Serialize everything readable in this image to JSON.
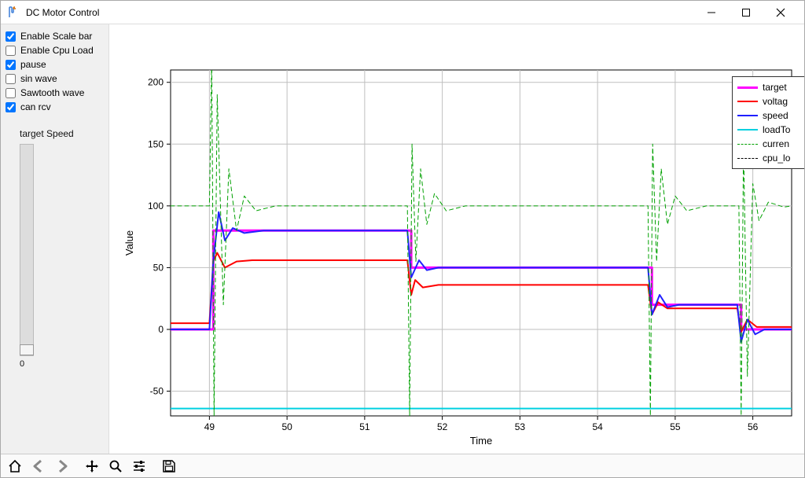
{
  "window": {
    "title": "DC Motor Control"
  },
  "sidebar": {
    "checks": [
      {
        "label": "Enable Scale bar",
        "checked": true
      },
      {
        "label": "Enable Cpu Load",
        "checked": false
      },
      {
        "label": "pause",
        "checked": true
      },
      {
        "label": "sin wave",
        "checked": false
      },
      {
        "label": "Sawtooth wave",
        "checked": false
      },
      {
        "label": "can rcv",
        "checked": true
      }
    ],
    "scale": {
      "label": "target Speed",
      "value": "0"
    }
  },
  "legend": {
    "items": [
      {
        "label": "target",
        "display": "target",
        "color": "#ff00ff",
        "style": "solid",
        "width": 3
      },
      {
        "label": "voltage",
        "display": "voltag",
        "color": "#ff0000",
        "style": "solid",
        "width": 2
      },
      {
        "label": "speed",
        "display": "speed",
        "color": "#2020ff",
        "style": "solid",
        "width": 2
      },
      {
        "label": "loadTorque",
        "display": "loadTo",
        "color": "#00d0e0",
        "style": "solid",
        "width": 2
      },
      {
        "label": "current",
        "display": "curren",
        "color": "#00a000",
        "style": "dashed",
        "width": 1
      },
      {
        "label": "cpu_load",
        "display": "cpu_lo",
        "color": "#000000",
        "style": "dashed",
        "width": 1
      }
    ]
  },
  "chart_data": {
    "type": "line",
    "xlabel": "Time",
    "ylabel": "Value",
    "xlim": [
      48.5,
      56.5
    ],
    "ylim": [
      -70,
      210
    ],
    "xticks": [
      49,
      50,
      51,
      52,
      53,
      54,
      55,
      56
    ],
    "yticks": [
      -50,
      0,
      50,
      100,
      150,
      200
    ],
    "grid": true,
    "series": [
      {
        "name": "target",
        "color": "#ff00ff",
        "style": "solid",
        "width": 3,
        "x": [
          48.5,
          49.05,
          49.05,
          51.6,
          51.6,
          54.7,
          54.7,
          55.85,
          55.85,
          56.5
        ],
        "y": [
          0,
          0,
          80,
          80,
          50,
          50,
          20,
          20,
          0,
          0
        ]
      },
      {
        "name": "voltage",
        "color": "#ff0000",
        "style": "solid",
        "width": 2,
        "x": [
          48.5,
          49.0,
          49.05,
          49.1,
          49.2,
          49.35,
          49.55,
          51.55,
          51.6,
          51.65,
          51.75,
          51.95,
          54.65,
          54.7,
          54.78,
          54.9,
          55.8,
          55.85,
          55.93,
          56.05,
          56.5
        ],
        "y": [
          5,
          5,
          55,
          62,
          50,
          55,
          56,
          56,
          28,
          40,
          34,
          36,
          36,
          12,
          22,
          17,
          17,
          -2,
          8,
          2,
          2
        ]
      },
      {
        "name": "speed",
        "color": "#2020ff",
        "style": "solid",
        "width": 2,
        "x": [
          48.5,
          49.0,
          49.05,
          49.12,
          49.2,
          49.3,
          49.45,
          49.7,
          51.55,
          51.6,
          51.7,
          51.8,
          51.95,
          54.65,
          54.7,
          54.8,
          54.9,
          55.05,
          55.8,
          55.85,
          55.93,
          56.03,
          56.15,
          56.5
        ],
        "y": [
          0,
          0,
          55,
          95,
          72,
          82,
          78,
          80,
          80,
          42,
          56,
          48,
          50,
          50,
          12,
          28,
          18,
          20,
          20,
          -10,
          8,
          -4,
          0,
          0
        ]
      },
      {
        "name": "loadTorque",
        "color": "#00d0e0",
        "style": "solid",
        "width": 2,
        "x": [
          48.5,
          56.5
        ],
        "y": [
          -64,
          -64
        ]
      },
      {
        "name": "current",
        "color": "#00a000",
        "style": "dashed",
        "width": 1,
        "x": [
          48.5,
          49.0,
          49.03,
          49.06,
          49.1,
          49.18,
          49.25,
          49.35,
          49.45,
          49.6,
          49.85,
          51.55,
          51.58,
          51.61,
          51.66,
          51.72,
          51.8,
          51.9,
          52.05,
          52.3,
          54.65,
          54.68,
          54.71,
          54.76,
          54.82,
          54.9,
          55.0,
          55.15,
          55.4,
          55.82,
          55.85,
          55.88,
          55.93,
          56.0,
          56.08,
          56.2,
          56.4,
          56.5
        ],
        "y": [
          100,
          100,
          220,
          -70,
          190,
          20,
          130,
          80,
          108,
          96,
          100,
          100,
          -70,
          150,
          55,
          130,
          85,
          110,
          96,
          100,
          100,
          -70,
          150,
          55,
          130,
          85,
          108,
          96,
          100,
          100,
          -70,
          150,
          -38,
          118,
          88,
          103,
          99,
          100
        ]
      }
    ]
  }
}
